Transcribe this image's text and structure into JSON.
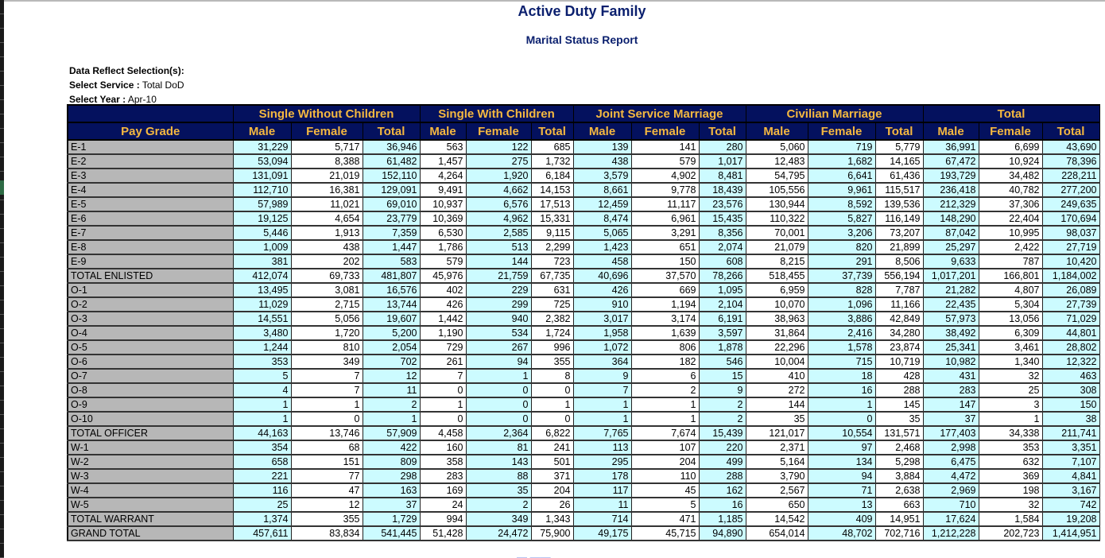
{
  "report": {
    "title": "Active Duty Family",
    "subtitle": "Marital Status Report"
  },
  "selections": {
    "heading": "Data Reflect Selection(s):",
    "service_label": "Select Service :",
    "service_value": " Total DoD",
    "year_label": "Select Year :",
    "year_value": " Apr-10"
  },
  "colors": {
    "header_bg": "#04115e",
    "header_text": "#f5b840",
    "label_bg": "#b7b7b7",
    "cyan_cell": "#ccfbff",
    "title_text": "#0a1f6e"
  },
  "table": {
    "pay_grade_header": "Pay Grade",
    "groups": [
      "Single Without Children",
      "Single With Children",
      "Joint Service Marriage",
      "Civilian Marriage",
      "Total"
    ],
    "subheaders": [
      "Male",
      "Female",
      "Total"
    ],
    "rows": [
      {
        "label": "E-1",
        "values": [
          "31,229",
          "5,717",
          "36,946",
          "563",
          "122",
          "685",
          "139",
          "141",
          "280",
          "5,060",
          "719",
          "5,779",
          "36,991",
          "6,699",
          "43,690"
        ]
      },
      {
        "label": "E-2",
        "values": [
          "53,094",
          "8,388",
          "61,482",
          "1,457",
          "275",
          "1,732",
          "438",
          "579",
          "1,017",
          "12,483",
          "1,682",
          "14,165",
          "67,472",
          "10,924",
          "78,396"
        ]
      },
      {
        "label": "E-3",
        "values": [
          "131,091",
          "21,019",
          "152,110",
          "4,264",
          "1,920",
          "6,184",
          "3,579",
          "4,902",
          "8,481",
          "54,795",
          "6,641",
          "61,436",
          "193,729",
          "34,482",
          "228,211"
        ]
      },
      {
        "label": "E-4",
        "values": [
          "112,710",
          "16,381",
          "129,091",
          "9,491",
          "4,662",
          "14,153",
          "8,661",
          "9,778",
          "18,439",
          "105,556",
          "9,961",
          "115,517",
          "236,418",
          "40,782",
          "277,200"
        ]
      },
      {
        "label": "E-5",
        "values": [
          "57,989",
          "11,021",
          "69,010",
          "10,937",
          "6,576",
          "17,513",
          "12,459",
          "11,117",
          "23,576",
          "130,944",
          "8,592",
          "139,536",
          "212,329",
          "37,306",
          "249,635"
        ]
      },
      {
        "label": "E-6",
        "values": [
          "19,125",
          "4,654",
          "23,779",
          "10,369",
          "4,962",
          "15,331",
          "8,474",
          "6,961",
          "15,435",
          "110,322",
          "5,827",
          "116,149",
          "148,290",
          "22,404",
          "170,694"
        ]
      },
      {
        "label": "E-7",
        "values": [
          "5,446",
          "1,913",
          "7,359",
          "6,530",
          "2,585",
          "9,115",
          "5,065",
          "3,291",
          "8,356",
          "70,001",
          "3,206",
          "73,207",
          "87,042",
          "10,995",
          "98,037"
        ]
      },
      {
        "label": "E-8",
        "values": [
          "1,009",
          "438",
          "1,447",
          "1,786",
          "513",
          "2,299",
          "1,423",
          "651",
          "2,074",
          "21,079",
          "820",
          "21,899",
          "25,297",
          "2,422",
          "27,719"
        ]
      },
      {
        "label": "E-9",
        "values": [
          "381",
          "202",
          "583",
          "579",
          "144",
          "723",
          "458",
          "150",
          "608",
          "8,215",
          "291",
          "8,506",
          "9,633",
          "787",
          "10,420"
        ]
      },
      {
        "label": "TOTAL ENLISTED",
        "values": [
          "412,074",
          "69,733",
          "481,807",
          "45,976",
          "21,759",
          "67,735",
          "40,696",
          "37,570",
          "78,266",
          "518,455",
          "37,739",
          "556,194",
          "1,017,201",
          "166,801",
          "1,184,002"
        ]
      },
      {
        "label": "O-1",
        "values": [
          "13,495",
          "3,081",
          "16,576",
          "402",
          "229",
          "631",
          "426",
          "669",
          "1,095",
          "6,959",
          "828",
          "7,787",
          "21,282",
          "4,807",
          "26,089"
        ]
      },
      {
        "label": "O-2",
        "values": [
          "11,029",
          "2,715",
          "13,744",
          "426",
          "299",
          "725",
          "910",
          "1,194",
          "2,104",
          "10,070",
          "1,096",
          "11,166",
          "22,435",
          "5,304",
          "27,739"
        ]
      },
      {
        "label": "O-3",
        "values": [
          "14,551",
          "5,056",
          "19,607",
          "1,442",
          "940",
          "2,382",
          "3,017",
          "3,174",
          "6,191",
          "38,963",
          "3,886",
          "42,849",
          "57,973",
          "13,056",
          "71,029"
        ]
      },
      {
        "label": "O-4",
        "values": [
          "3,480",
          "1,720",
          "5,200",
          "1,190",
          "534",
          "1,724",
          "1,958",
          "1,639",
          "3,597",
          "31,864",
          "2,416",
          "34,280",
          "38,492",
          "6,309",
          "44,801"
        ]
      },
      {
        "label": "O-5",
        "values": [
          "1,244",
          "810",
          "2,054",
          "729",
          "267",
          "996",
          "1,072",
          "806",
          "1,878",
          "22,296",
          "1,578",
          "23,874",
          "25,341",
          "3,461",
          "28,802"
        ]
      },
      {
        "label": "O-6",
        "values": [
          "353",
          "349",
          "702",
          "261",
          "94",
          "355",
          "364",
          "182",
          "546",
          "10,004",
          "715",
          "10,719",
          "10,982",
          "1,340",
          "12,322"
        ]
      },
      {
        "label": "O-7",
        "values": [
          "5",
          "7",
          "12",
          "7",
          "1",
          "8",
          "9",
          "6",
          "15",
          "410",
          "18",
          "428",
          "431",
          "32",
          "463"
        ]
      },
      {
        "label": "O-8",
        "values": [
          "4",
          "7",
          "11",
          "0",
          "0",
          "0",
          "7",
          "2",
          "9",
          "272",
          "16",
          "288",
          "283",
          "25",
          "308"
        ]
      },
      {
        "label": "O-9",
        "values": [
          "1",
          "1",
          "2",
          "1",
          "0",
          "1",
          "1",
          "1",
          "2",
          "144",
          "1",
          "145",
          "147",
          "3",
          "150"
        ]
      },
      {
        "label": "O-10",
        "values": [
          "1",
          "0",
          "1",
          "0",
          "0",
          "0",
          "1",
          "1",
          "2",
          "35",
          "0",
          "35",
          "37",
          "1",
          "38"
        ]
      },
      {
        "label": "TOTAL OFFICER",
        "values": [
          "44,163",
          "13,746",
          "57,909",
          "4,458",
          "2,364",
          "6,822",
          "7,765",
          "7,674",
          "15,439",
          "121,017",
          "10,554",
          "131,571",
          "177,403",
          "34,338",
          "211,741"
        ]
      },
      {
        "label": "W-1",
        "values": [
          "354",
          "68",
          "422",
          "160",
          "81",
          "241",
          "113",
          "107",
          "220",
          "2,371",
          "97",
          "2,468",
          "2,998",
          "353",
          "3,351"
        ]
      },
      {
        "label": "W-2",
        "values": [
          "658",
          "151",
          "809",
          "358",
          "143",
          "501",
          "295",
          "204",
          "499",
          "5,164",
          "134",
          "5,298",
          "6,475",
          "632",
          "7,107"
        ]
      },
      {
        "label": "W-3",
        "values": [
          "221",
          "77",
          "298",
          "283",
          "88",
          "371",
          "178",
          "110",
          "288",
          "3,790",
          "94",
          "3,884",
          "4,472",
          "369",
          "4,841"
        ]
      },
      {
        "label": "W-4",
        "values": [
          "116",
          "47",
          "163",
          "169",
          "35",
          "204",
          "117",
          "45",
          "162",
          "2,567",
          "71",
          "2,638",
          "2,969",
          "198",
          "3,167"
        ]
      },
      {
        "label": "W-5",
        "values": [
          "25",
          "12",
          "37",
          "24",
          "2",
          "26",
          "11",
          "5",
          "16",
          "650",
          "13",
          "663",
          "710",
          "32",
          "742"
        ]
      },
      {
        "label": "TOTAL WARRANT",
        "values": [
          "1,374",
          "355",
          "1,729",
          "994",
          "349",
          "1,343",
          "714",
          "471",
          "1,185",
          "14,542",
          "409",
          "14,951",
          "17,624",
          "1,584",
          "19,208"
        ]
      },
      {
        "label": "GRAND TOTAL",
        "values": [
          "457,611",
          "83,834",
          "541,445",
          "51,428",
          "24,472",
          "75,900",
          "49,175",
          "45,715",
          "94,890",
          "654,014",
          "48,702",
          "702,716",
          "1,212,228",
          "202,723",
          "1,414,951"
        ]
      }
    ]
  },
  "footer": {
    "partial_link": "— ——"
  }
}
